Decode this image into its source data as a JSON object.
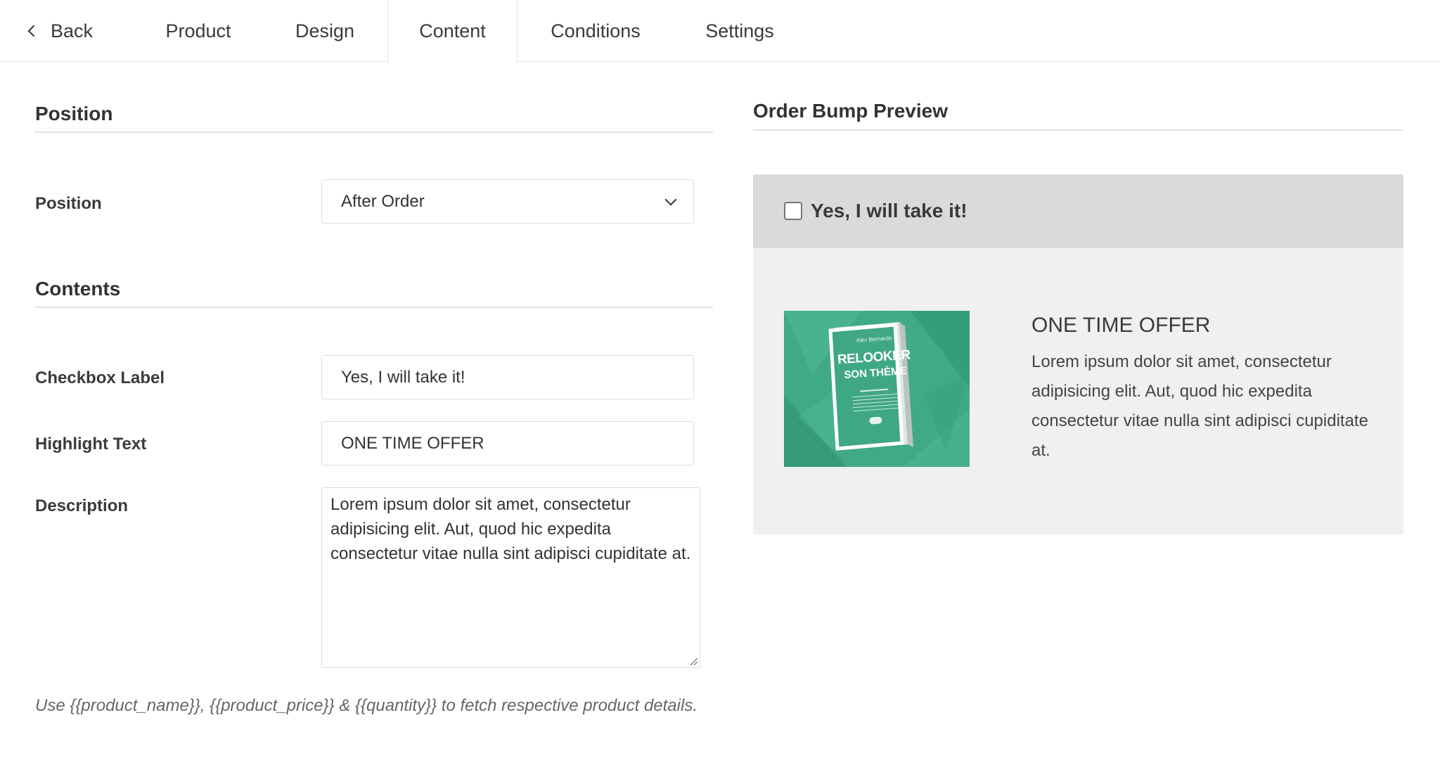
{
  "tabs": {
    "back": "Back",
    "items": [
      "Product",
      "Design",
      "Content",
      "Conditions",
      "Settings"
    ],
    "active": "Content"
  },
  "left": {
    "position_section": "Position",
    "position_label": "Position",
    "position_value": "After Order",
    "contents_section": "Contents",
    "checkbox_label_label": "Checkbox Label",
    "checkbox_label_value": "Yes, I will take it!",
    "highlight_label": "Highlight Text",
    "highlight_value": "ONE TIME OFFER",
    "description_label": "Description",
    "description_value": "Lorem ipsum dolor sit amet, consectetur adipisicing elit. Aut, quod hic expedita consectetur vitae nulla sint adipisci cupiditate at.",
    "hint": "Use {{product_name}}, {{product_price}} & {{quantity}} to fetch respective product details."
  },
  "preview": {
    "title": "Order Bump Preview",
    "checkbox_label": "Yes, I will take it!",
    "checked": false,
    "offer_title": "ONE TIME OFFER",
    "offer_desc": "Lorem ipsum dolor sit amet, consectetur adipisicing elit. Aut, quod hic expedita consectetur vitae nulla sint adipisci cupiditate at.",
    "book": {
      "author": "Alex Bernardo",
      "title_line1": "RELOOKER",
      "title_line2": "SON THÈME"
    }
  },
  "colors": {
    "accent": "#3faa85",
    "preview_bg": "#f0f0f0",
    "preview_head_bg": "#dadada"
  }
}
